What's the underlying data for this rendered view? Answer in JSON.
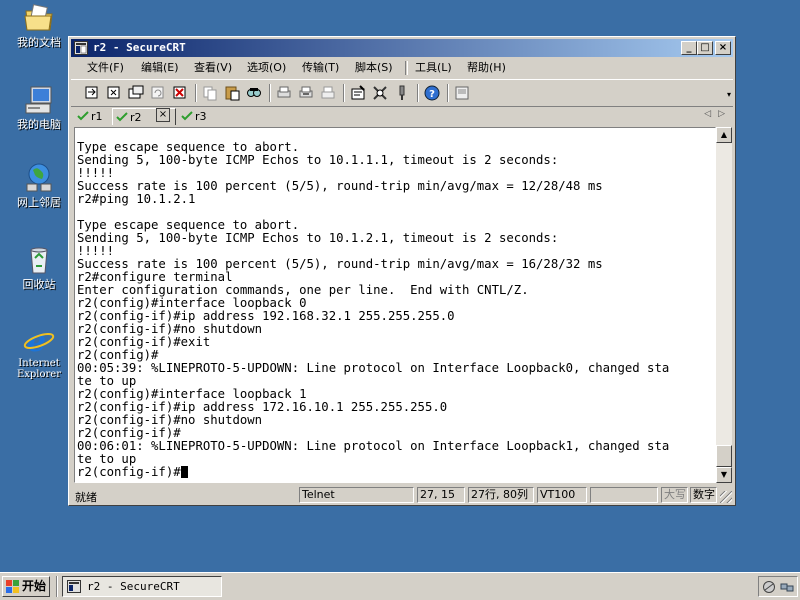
{
  "desktop": {
    "icons": [
      {
        "label": "我的文档",
        "icon": "folder-documents-icon"
      },
      {
        "label": "我的电脑",
        "icon": "computer-icon"
      },
      {
        "label": "网上邻居",
        "icon": "network-icon"
      },
      {
        "label": "回收站",
        "icon": "recycle-bin-icon"
      },
      {
        "label_line1": "Internet",
        "label_line2": "Explorer",
        "icon": "internet-explorer-icon"
      }
    ]
  },
  "window": {
    "title": "r2 - SecureCRT",
    "controls": {
      "minimize": "_",
      "maximize": "□",
      "close": "×"
    },
    "menu": [
      "文件(F)",
      "编辑(E)",
      "查看(V)",
      "选项(O)",
      "传输(T)",
      "脚本(S)",
      "工具(L)",
      "帮助(H)"
    ],
    "tabs": [
      {
        "label": "r1",
        "active": false
      },
      {
        "label": "r2",
        "active": true
      },
      {
        "label": "r3",
        "active": false
      }
    ],
    "tab_close_glyph": "×",
    "tab_scroll": {
      "left": "◁",
      "right": "▷"
    },
    "terminal_lines": [
      "Type escape sequence to abort.",
      "Sending 5, 100-byte ICMP Echos to 10.1.1.1, timeout is 2 seconds:",
      "!!!!!",
      "Success rate is 100 percent (5/5), round-trip min/avg/max = 12/28/48 ms",
      "r2#ping 10.1.2.1",
      "",
      "Type escape sequence to abort.",
      "Sending 5, 100-byte ICMP Echos to 10.1.2.1, timeout is 2 seconds:",
      "!!!!!",
      "Success rate is 100 percent (5/5), round-trip min/avg/max = 16/28/32 ms",
      "r2#configure terminal",
      "Enter configuration commands, one per line.  End with CNTL/Z.",
      "r2(config)#interface loopback 0",
      "r2(config-if)#ip address 192.168.32.1 255.255.255.0",
      "r2(config-if)#no shutdown",
      "r2(config-if)#exit",
      "r2(config)#",
      "00:05:39: %LINEPROTO-5-UPDOWN: Line protocol on Interface Loopback0, changed sta",
      "te to up",
      "r2(config)#interface loopback 1",
      "r2(config-if)#ip address 172.16.10.1 255.255.255.0",
      "r2(config-if)#no shutdown",
      "r2(config-if)#",
      "00:06:01: %LINEPROTO-5-UPDOWN: Line protocol on Interface Loopback1, changed sta",
      "te to up",
      "r2(config-if)#"
    ],
    "statusbar": {
      "ready": "就绪",
      "protocol": "Telnet",
      "cursor_pos": "27, 15",
      "size": "27行, 80列",
      "emulation": "VT100",
      "caps": "大写",
      "num": "数字"
    }
  },
  "taskbar": {
    "start_label": "开始",
    "task_label": "r2 - SecureCRT"
  },
  "colors": {
    "desktop": "#3a6ea5",
    "title_start": "#0a246a",
    "title_end": "#a6caf0",
    "chrome": "#d4d0c8",
    "check_green": "#2e9e2e"
  }
}
